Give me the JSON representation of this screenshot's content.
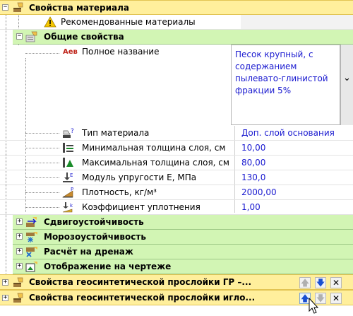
{
  "material_properties": {
    "title": "Свойства материала",
    "recommended_materials_label": "Рекомендованные материалы"
  },
  "general_properties": {
    "title": "Общие свойства",
    "full_name_prefix": "Аев",
    "full_name_label": "Полное название",
    "full_name_value": [
      "Песок крупный, с",
      "содержанием",
      "пылевато-глинистой",
      "фракции 5%"
    ],
    "rows": [
      {
        "label": "Тип материала",
        "value": "Доп. слой основания",
        "icon": "question-material-icon"
      },
      {
        "label": "Минимальная толщина слоя, см",
        "value": "10,00",
        "icon": "min-thickness-icon"
      },
      {
        "label": "Максимальная толщина слоя, см",
        "value": "80,00",
        "icon": "max-thickness-icon"
      },
      {
        "label": "Модуль упругости Е, МПа",
        "value": "130,0",
        "icon": "elasticity-modulus-icon"
      },
      {
        "label": "Плотность, кг/м³",
        "value": "2000,00",
        "icon": "density-icon"
      },
      {
        "label": "Коэффициент уплотнения",
        "value": "1,00",
        "icon": "compaction-icon"
      }
    ]
  },
  "collapsed_sections": [
    {
      "title": "Сдвигоустойчивость",
      "icon": "shear-resistance-icon"
    },
    {
      "title": "Морозоустойчивость",
      "icon": "frost-resistance-icon"
    },
    {
      "title": "Расчёт на дренаж",
      "icon": "drainage-icon"
    },
    {
      "title": "Отображение на чертеже",
      "icon": "drawing-display-icon"
    }
  ],
  "geosynthetic_layers": [
    {
      "title": "Свойства геосинтетической прослойки ГР –..."
    },
    {
      "title": "Свойства геосинтетической прослойки игло..."
    }
  ],
  "glyphs": {
    "plus": "+",
    "minus": "−",
    "up": "🡅",
    "down": "🡇",
    "close": "✕",
    "dropdown": "⌄"
  },
  "colors": {
    "section_bg": "#d2f5b4",
    "top_bg": "#ffef9c",
    "value_text": "#1a1ad0"
  }
}
